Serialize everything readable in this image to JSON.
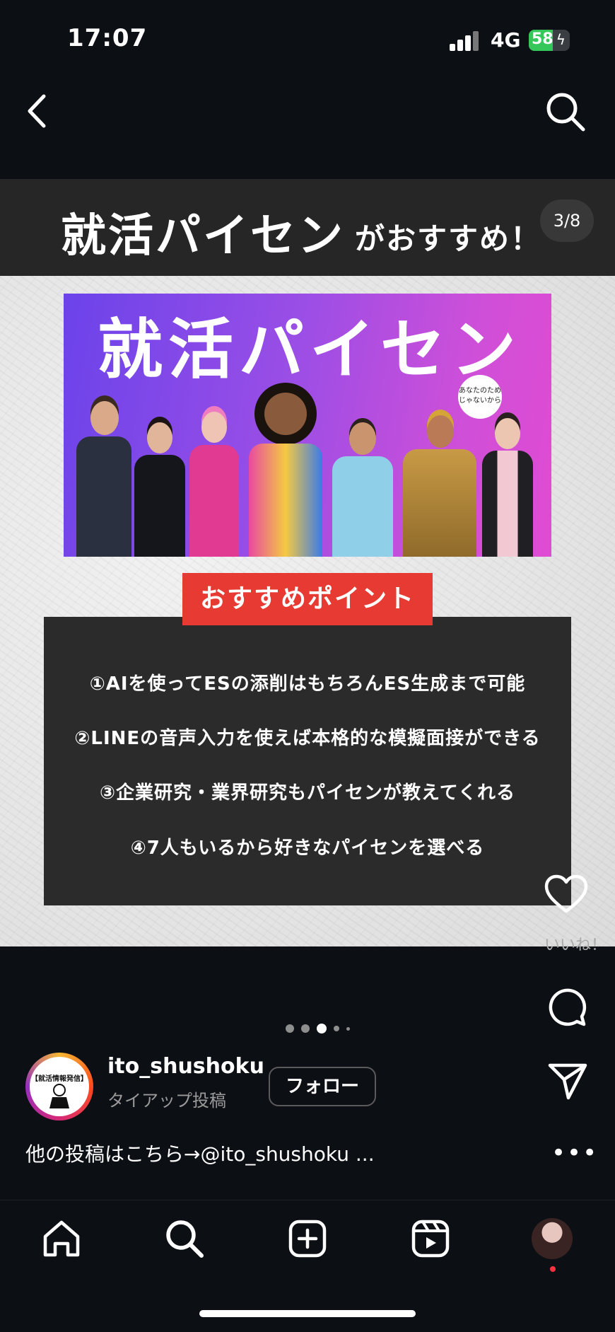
{
  "status_bar": {
    "time": "17:07",
    "network": "4G",
    "battery": "58",
    "battery_level": 0.58
  },
  "nav": {
    "back_icon": "chevron-left-icon",
    "search_icon": "search-icon"
  },
  "slide": {
    "counter": "3/8",
    "title_main": "就活パイセン",
    "title_sub": "がおすすめ！",
    "banner_title": "就活パイセン",
    "banner_bubble": "あなたのため じゃないから",
    "tag": "おすすめポイント",
    "points": [
      "①AIを使ってESの添削はもちろんES生成まで可能",
      "②LINEの音声入力を使えば本格的な模擬面接ができる",
      "③企業研究・業界研究もパイセンが教えてくれる",
      "④7人もいるから好きなパイセンを選べる"
    ]
  },
  "actions": {
    "like_label": "いいね！",
    "more": "•••"
  },
  "post": {
    "avatar_text": "【就活情報発信】",
    "username": "ito_shushoku",
    "subtitle": "タイアップ投稿",
    "follow_label": "フォロー",
    "caption": "他の投稿はこちら→@ito_shushoku ..."
  },
  "tabs": [
    "home-icon",
    "search-icon",
    "create-icon",
    "reels-icon",
    "profile-avatar"
  ],
  "colors": {
    "background": "#0c0f14",
    "tag_red": "#e63a32",
    "panel": "#2b2b2b"
  }
}
